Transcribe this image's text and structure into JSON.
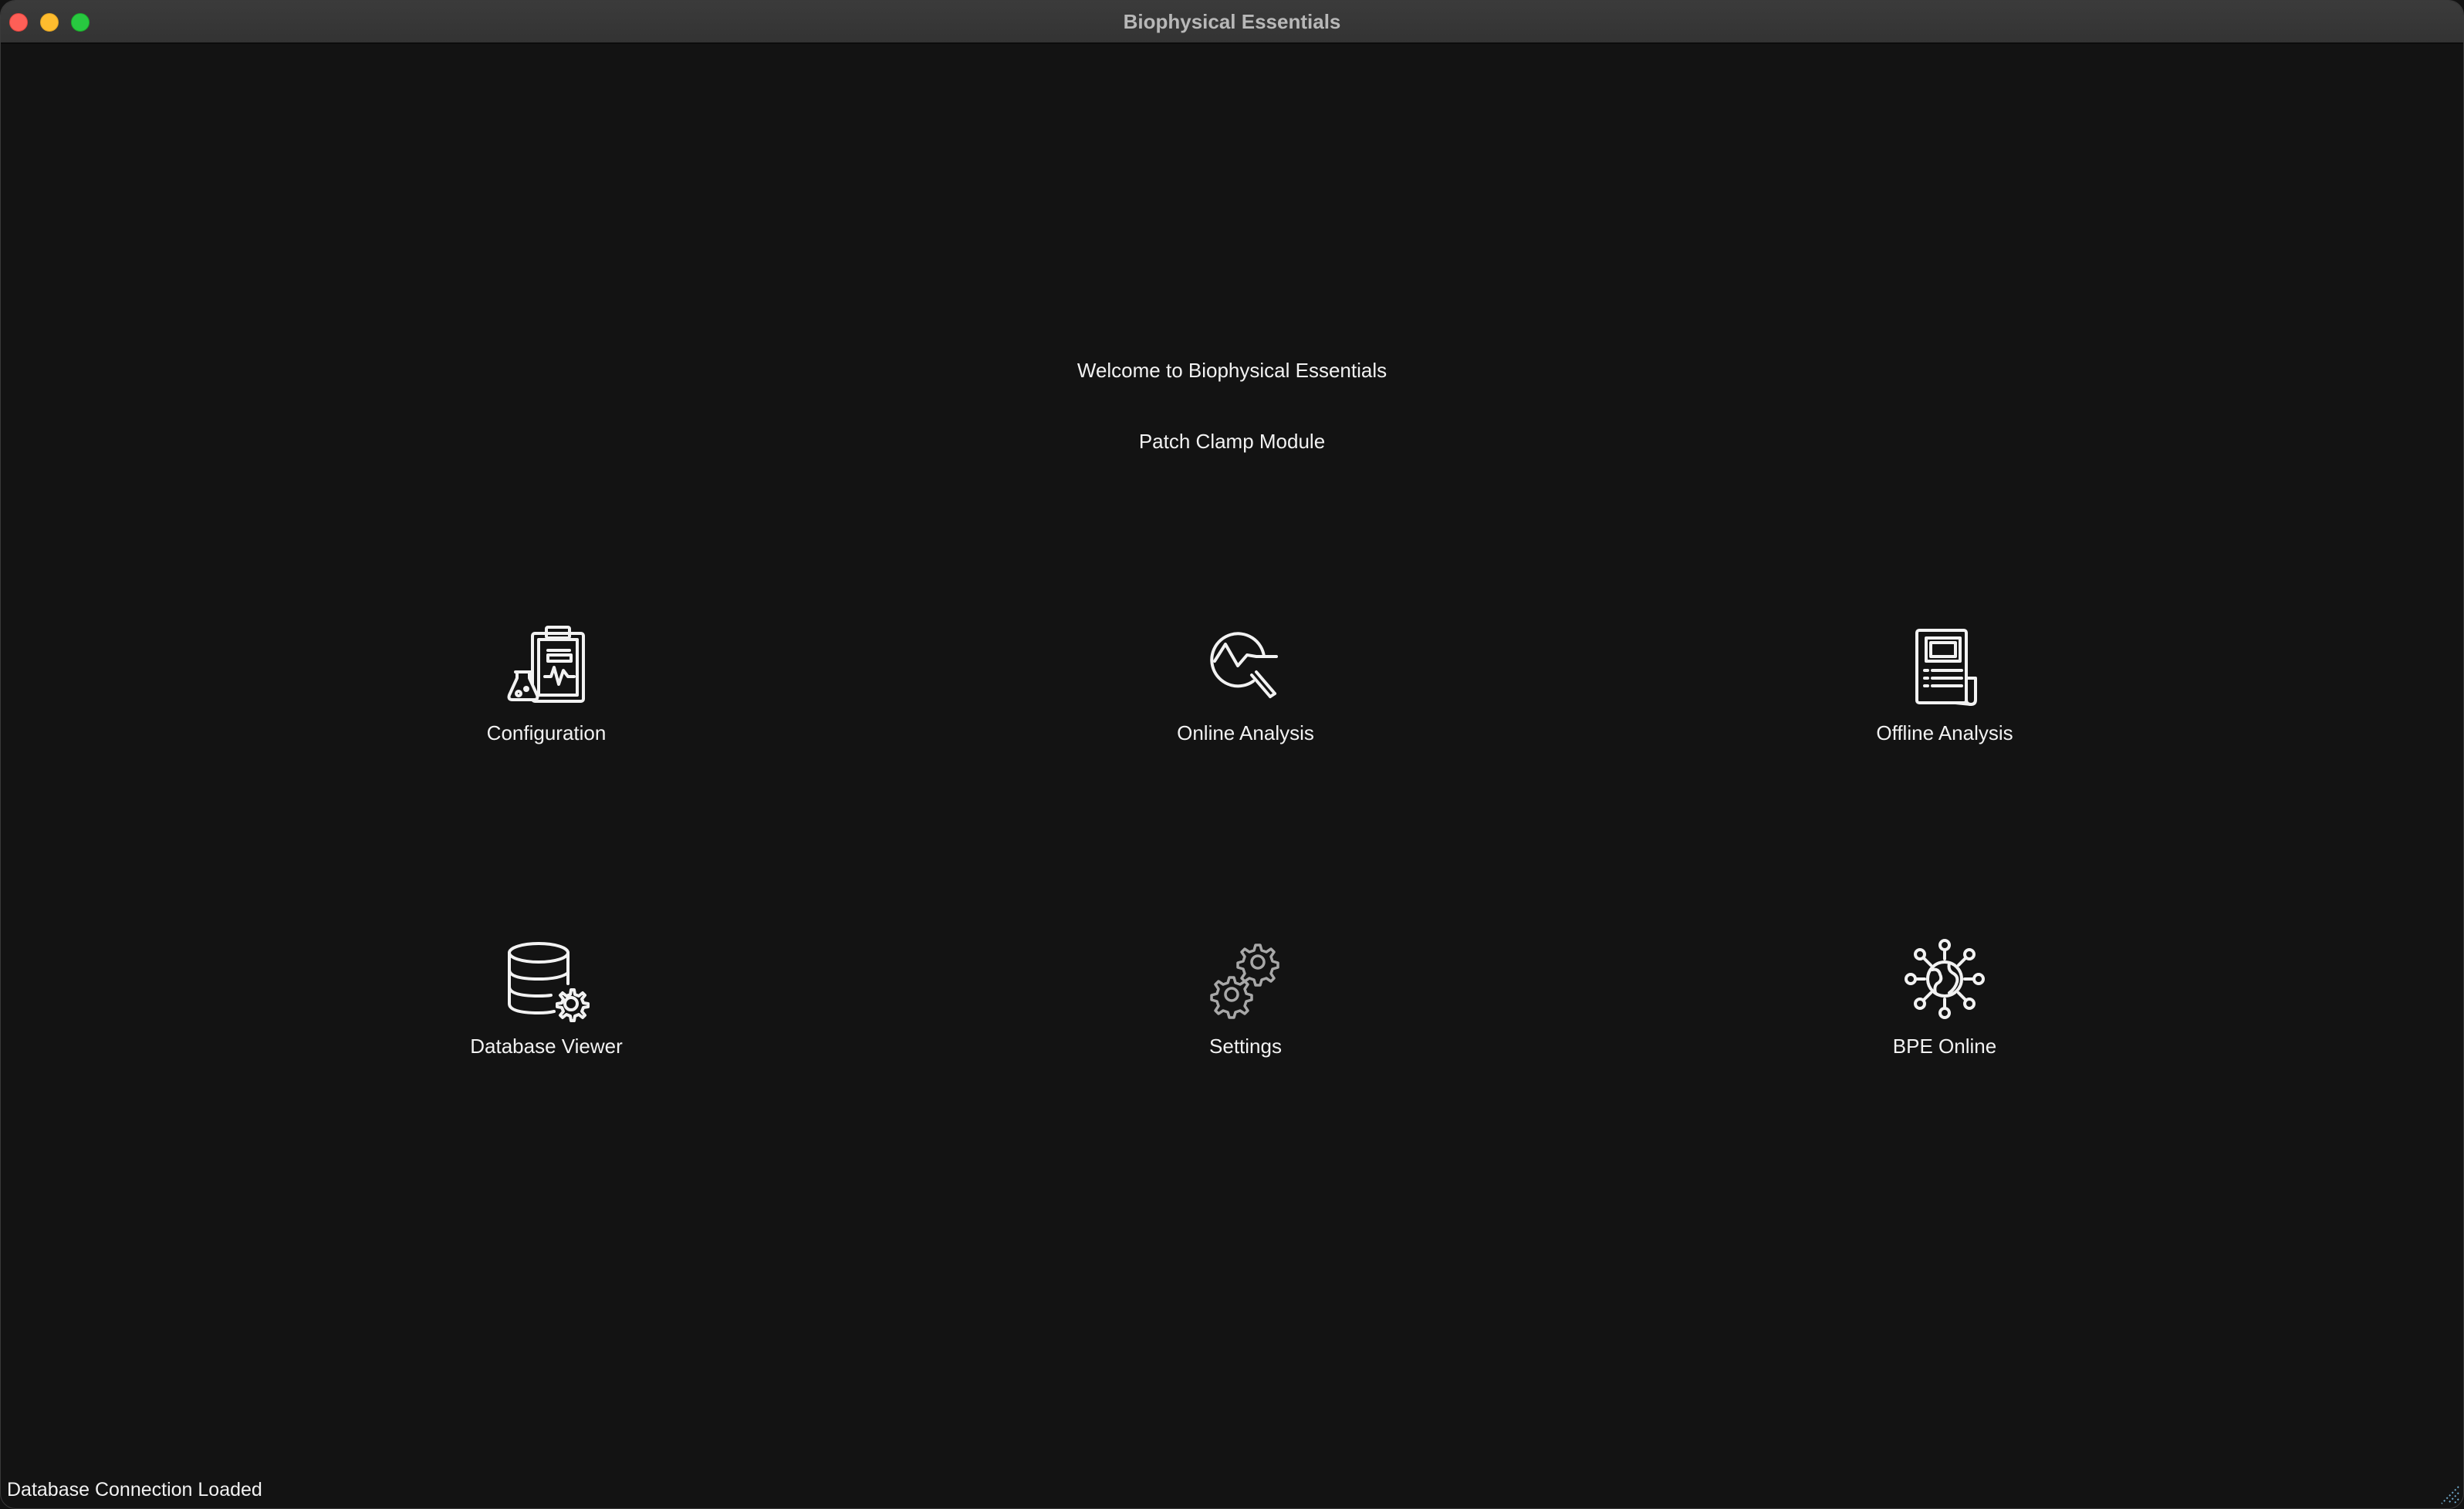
{
  "window": {
    "title": "Biophysical Essentials"
  },
  "welcome": {
    "heading": "Welcome to Biophysical Essentials",
    "subheading": "Patch Clamp Module"
  },
  "tiles": [
    {
      "label": "Configuration",
      "icon": "clipboard-flask-icon"
    },
    {
      "label": "Online Analysis",
      "icon": "chart-magnifier-icon"
    },
    {
      "label": "Offline Analysis",
      "icon": "document-report-icon"
    },
    {
      "label": "Database Viewer",
      "icon": "database-gear-icon"
    },
    {
      "label": "Settings",
      "icon": "gears-icon"
    },
    {
      "label": "BPE Online",
      "icon": "globe-network-icon"
    }
  ],
  "status": {
    "text": "Database Connection Loaded"
  },
  "colors": {
    "background": "#131313",
    "titlebar": "#363636",
    "text": "#f2f2f2",
    "close": "#fe5f57",
    "minimize": "#febc2e",
    "maximize": "#28c840"
  }
}
